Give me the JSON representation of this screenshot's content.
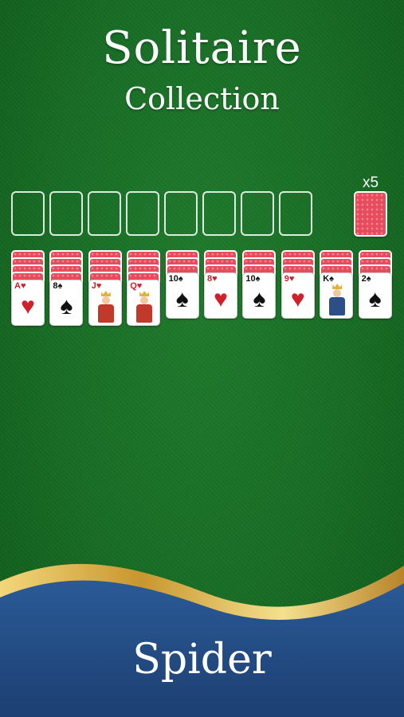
{
  "header": {
    "title": "Solitaire",
    "subtitle": "Collection"
  },
  "stock": {
    "count_label": "x5"
  },
  "foundations": {
    "count": 8
  },
  "tableau": [
    {
      "backs": 4,
      "top": {
        "rank": "A",
        "suit": "♥",
        "color": "red",
        "royal": false
      }
    },
    {
      "backs": 4,
      "top": {
        "rank": "8",
        "suit": "♠",
        "color": "black",
        "royal": false
      }
    },
    {
      "backs": 4,
      "top": {
        "rank": "J",
        "suit": "♥",
        "color": "red",
        "royal": true
      }
    },
    {
      "backs": 4,
      "top": {
        "rank": "Q",
        "suit": "♥",
        "color": "red",
        "royal": true
      }
    },
    {
      "backs": 3,
      "top": {
        "rank": "10",
        "suit": "♠",
        "color": "black",
        "royal": false
      }
    },
    {
      "backs": 3,
      "top": {
        "rank": "8",
        "suit": "♥",
        "color": "red",
        "royal": false
      }
    },
    {
      "backs": 3,
      "top": {
        "rank": "10",
        "suit": "♠",
        "color": "black",
        "royal": false
      }
    },
    {
      "backs": 3,
      "top": {
        "rank": "9",
        "suit": "♥",
        "color": "red",
        "royal": false
      }
    },
    {
      "backs": 3,
      "top": {
        "rank": "K",
        "suit": "♠",
        "color": "black",
        "royal": true
      }
    },
    {
      "backs": 3,
      "top": {
        "rank": "2",
        "suit": "♠",
        "color": "black",
        "royal": false
      }
    }
  ],
  "footer": {
    "game_name": "Spider"
  },
  "colors": {
    "felt": "#176b24",
    "card_back": "#e74c5c",
    "footer_blue": "#1f4a86",
    "gold": "#d6a93a"
  }
}
